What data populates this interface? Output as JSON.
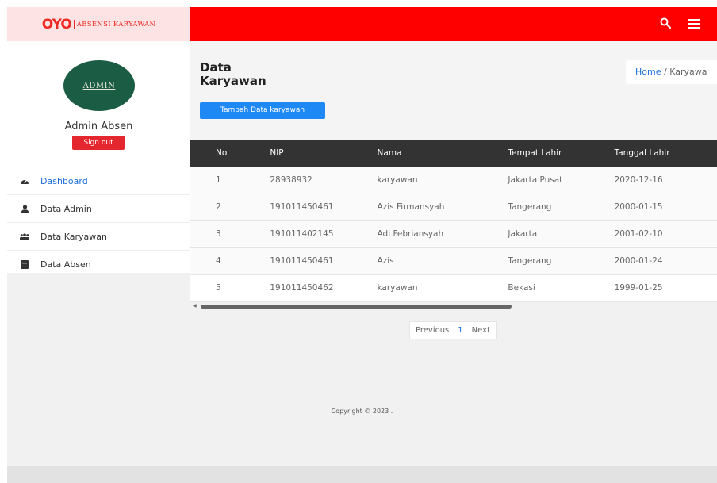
{
  "brand": {
    "logo_text": "OYO",
    "subtitle": "ABSENSI KARYAWAN",
    "color": "#ee2a24"
  },
  "topbar": {
    "color": "#ff0000",
    "icons": [
      "search-icon",
      "hamburger-menu-icon"
    ]
  },
  "sidebar": {
    "avatar_text": "ADMIN",
    "user_name": "Admin Absen",
    "signout_label": "Sign out",
    "items": [
      {
        "label": "Dashboard",
        "icon": "dashboard-icon",
        "active": true
      },
      {
        "label": "Data Admin",
        "icon": "user-icon",
        "active": false
      },
      {
        "label": "Data Karyawan",
        "icon": "users-icon",
        "active": false
      },
      {
        "label": "Data Absen",
        "icon": "book-icon",
        "active": false
      }
    ]
  },
  "main": {
    "title_line1": "Data",
    "title_line2": "Karyawan",
    "breadcrumb_home": "Home",
    "breadcrumb_sep": "/",
    "breadcrumb_current": "Karyawa",
    "add_button": "Tambah Data karyawan"
  },
  "table": {
    "columns": [
      "No",
      "NIP",
      "Nama",
      "Tempat Lahir",
      "Tanggal Lahir"
    ],
    "rows": [
      [
        "1",
        "28938932",
        "karyawan",
        "Jakarta Pusat",
        "2020-12-16"
      ],
      [
        "2",
        "191011450461",
        "Azis Firmansyah",
        "Tangerang",
        "2000-01-15"
      ],
      [
        "3",
        "191011402145",
        "Adi Febriansyah",
        "Jakarta",
        "2001-02-10"
      ],
      [
        "4",
        "191011450461",
        "Azis",
        "Tangerang",
        "2000-01-24"
      ],
      [
        "5",
        "191011450462",
        "karyawan",
        "Bekasi",
        "1999-01-25"
      ]
    ]
  },
  "pagination": {
    "previous": "Previous",
    "current": "1",
    "next": "Next"
  },
  "footer": {
    "copyright": "Copyright © 2023 ."
  }
}
